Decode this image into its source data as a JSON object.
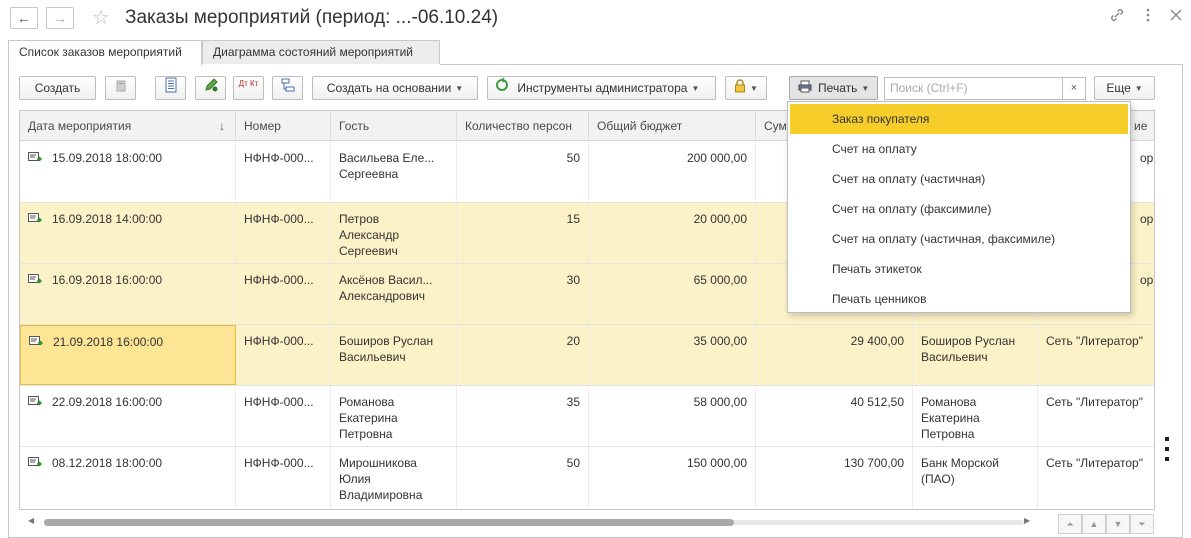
{
  "window": {
    "title": "Заказы мероприятий (период: ...-06.10.24)",
    "nav_back": "←",
    "nav_forward": "→",
    "icons": [
      "star-icon",
      "link-icon",
      "more-vertical-icon",
      "close-icon"
    ]
  },
  "tabs": [
    {
      "label": "Список заказов мероприятий",
      "active": true
    },
    {
      "label": "Диаграмма состояний мероприятий",
      "active": false
    }
  ],
  "toolbar": {
    "create": "Создать",
    "create_based_on": "Создать на основании",
    "admin_tools": "Инструменты администратора",
    "print": "Печать",
    "search_placeholder": "Поиск (Ctrl+F)",
    "search_clear": "×",
    "more": "Еще",
    "dtkt": "Дт Кт"
  },
  "table": {
    "columns": [
      "Дата мероприятия",
      "Номер",
      "Гость",
      "Количество персон",
      "Общий бюджет",
      "Сум",
      "",
      "ие"
    ],
    "sort_indicator": "↓",
    "rows": [
      {
        "date": "15.09.2018 18:00:00",
        "number": "НФНФ-000...",
        "guest": [
          "Васильева Еле...",
          "Сергеевна"
        ],
        "persons": "50",
        "budget": "200 000,00",
        "sum": "",
        "contractor": [],
        "org": "ор\""
      },
      {
        "date": "16.09.2018 14:00:00",
        "number": "НФНФ-000...",
        "guest": [
          "Петров",
          "Александр",
          "Сергеевич"
        ],
        "persons": "15",
        "budget": "20 000,00",
        "sum": "",
        "contractor": [],
        "org": "ор\""
      },
      {
        "date": "16.09.2018 16:00:00",
        "number": "НФНФ-000...",
        "guest": [
          "Аксёнов Васил...",
          "Александрович"
        ],
        "persons": "30",
        "budget": "65 000,00",
        "sum": "",
        "contractor": [],
        "org": "ор\""
      },
      {
        "date": "21.09.2018 16:00:00",
        "number": "НФНФ-000...",
        "guest": [
          "Боширов Руслан",
          "Васильевич"
        ],
        "persons": "20",
        "budget": "35 000,00",
        "sum": "29 400,00",
        "contractor": [
          "Боширов Руслан",
          "Васильевич"
        ],
        "org": "Сеть \"Литератор\""
      },
      {
        "date": "22.09.2018 16:00:00",
        "number": "НФНФ-000...",
        "guest": [
          "Романова",
          "Екатерина",
          "Петровна"
        ],
        "persons": "35",
        "budget": "58 000,00",
        "sum": "40 512,50",
        "contractor": [
          "Романова",
          "Екатерина",
          "Петровна"
        ],
        "org": "Сеть \"Литератор\""
      },
      {
        "date": "08.12.2018 18:00:00",
        "number": "НФНФ-000...",
        "guest": [
          "Мирошникова",
          "Юлия",
          "Владимировна"
        ],
        "persons": "50",
        "budget": "150 000,00",
        "sum": "130 700,00",
        "contractor": [
          "Банк Морской",
          "(ПАО)"
        ],
        "org": "Сеть \"Литератор\""
      }
    ]
  },
  "print_menu": {
    "items": [
      "Заказ покупателя",
      "Счет на оплату",
      "Счет на оплату (частичная)",
      "Счет на оплату (факсимиле)",
      "Счет на оплату (частичная, факсимиле)",
      "Печать этикеток",
      "Печать ценников"
    ],
    "active_index": 0
  },
  "colors": {
    "highlight_row": "#fcf2c8",
    "selected_cell": "#fde596",
    "menu_active": "#f7cd2a"
  }
}
